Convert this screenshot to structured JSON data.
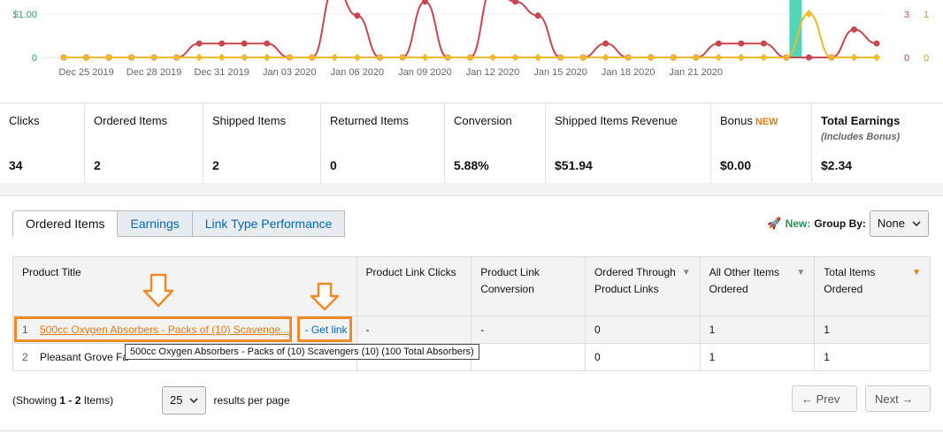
{
  "chart_data": {
    "type": "line",
    "x_tick_labels": [
      "Dec 25 2019",
      "Dec 28 2019",
      "Dec 31 2019",
      "Jan 03 2020",
      "Jan 06 2020",
      "Jan 09 2020",
      "Jan 12 2020",
      "Jan 15 2020",
      "Jan 18 2020",
      "Jan 21 2020"
    ],
    "left_axis_ticks": [
      "$1.00",
      "0"
    ],
    "right_axis_ticks_a": [
      "3",
      "0"
    ],
    "right_axis_ticks_b": [
      "1",
      "0"
    ],
    "series": [
      {
        "color": "#c9464e",
        "axis": "right_a",
        "values": [
          0,
          0,
          0,
          0,
          0,
          0,
          1,
          1,
          1,
          1,
          0,
          0,
          5,
          3,
          0,
          0,
          4,
          0,
          0,
          5,
          4,
          3,
          0,
          0,
          1,
          0,
          0,
          0,
          0,
          1,
          1,
          1,
          0,
          0,
          0,
          2,
          1
        ]
      },
      {
        "color": "#f0b82a",
        "axis": "left",
        "values": [
          0,
          0,
          0,
          0,
          0,
          0,
          0,
          0,
          0,
          0,
          0,
          0,
          0,
          0,
          0,
          0,
          0,
          0,
          0,
          0,
          0,
          0,
          0,
          0,
          0,
          0,
          0,
          0,
          0,
          0,
          0,
          0,
          0,
          3,
          0,
          0,
          0
        ]
      }
    ],
    "bar": {
      "color": "#4fd6b6",
      "index": 33
    }
  },
  "stats": [
    {
      "label": "Clicks",
      "value": "34"
    },
    {
      "label": "Ordered Items",
      "value": "2"
    },
    {
      "label": "Shipped Items",
      "value": "2"
    },
    {
      "label": "Returned Items",
      "value": "0"
    },
    {
      "label": "Conversion",
      "value": "5.88%"
    },
    {
      "label": "Shipped Items Revenue",
      "value": "$51.94"
    },
    {
      "label": "Bonus",
      "badge": "NEW",
      "value": "$0.00"
    },
    {
      "label": "Total Earnings",
      "sub": "(Includes Bonus)",
      "value": "$2.34"
    }
  ],
  "tabs": [
    "Ordered Items",
    "Earnings",
    "Link Type Performance"
  ],
  "group_by": {
    "new_label": "New:",
    "label": "Group By:",
    "value": "None"
  },
  "table": {
    "headers": [
      "Product Title",
      "Product Link Clicks",
      "Product Link Conversion",
      "Ordered Through Product Links",
      "All Other Items Ordered",
      "Total Items Ordered"
    ],
    "rows": [
      {
        "num": "1",
        "title": "500cc Oxygen Absorbers - Packs of (10) Scavenge...",
        "get_link": "- Get link",
        "clicks": "-",
        "conversion": "-",
        "ordered_through": "0",
        "other": "1",
        "total": "1"
      },
      {
        "num": "2",
        "title": "Pleasant Grove Fa",
        "clicks": "",
        "conversion": "",
        "ordered_through": "0",
        "other": "1",
        "total": "1"
      }
    ],
    "tooltip": "500cc Oxygen Absorbers - Packs of (10) Scavengers (10) (100 Total Absorbers)"
  },
  "footer": {
    "showing_prefix": "(Showing ",
    "showing_range": "1 - 2",
    "showing_suffix": " Items)",
    "per_page": "25",
    "per_page_label": "results per page",
    "prev": "← Prev",
    "next": "Next →"
  },
  "colors": {
    "accent": "#e47911",
    "link": "#0066c0",
    "highlight": "#f08a24"
  }
}
